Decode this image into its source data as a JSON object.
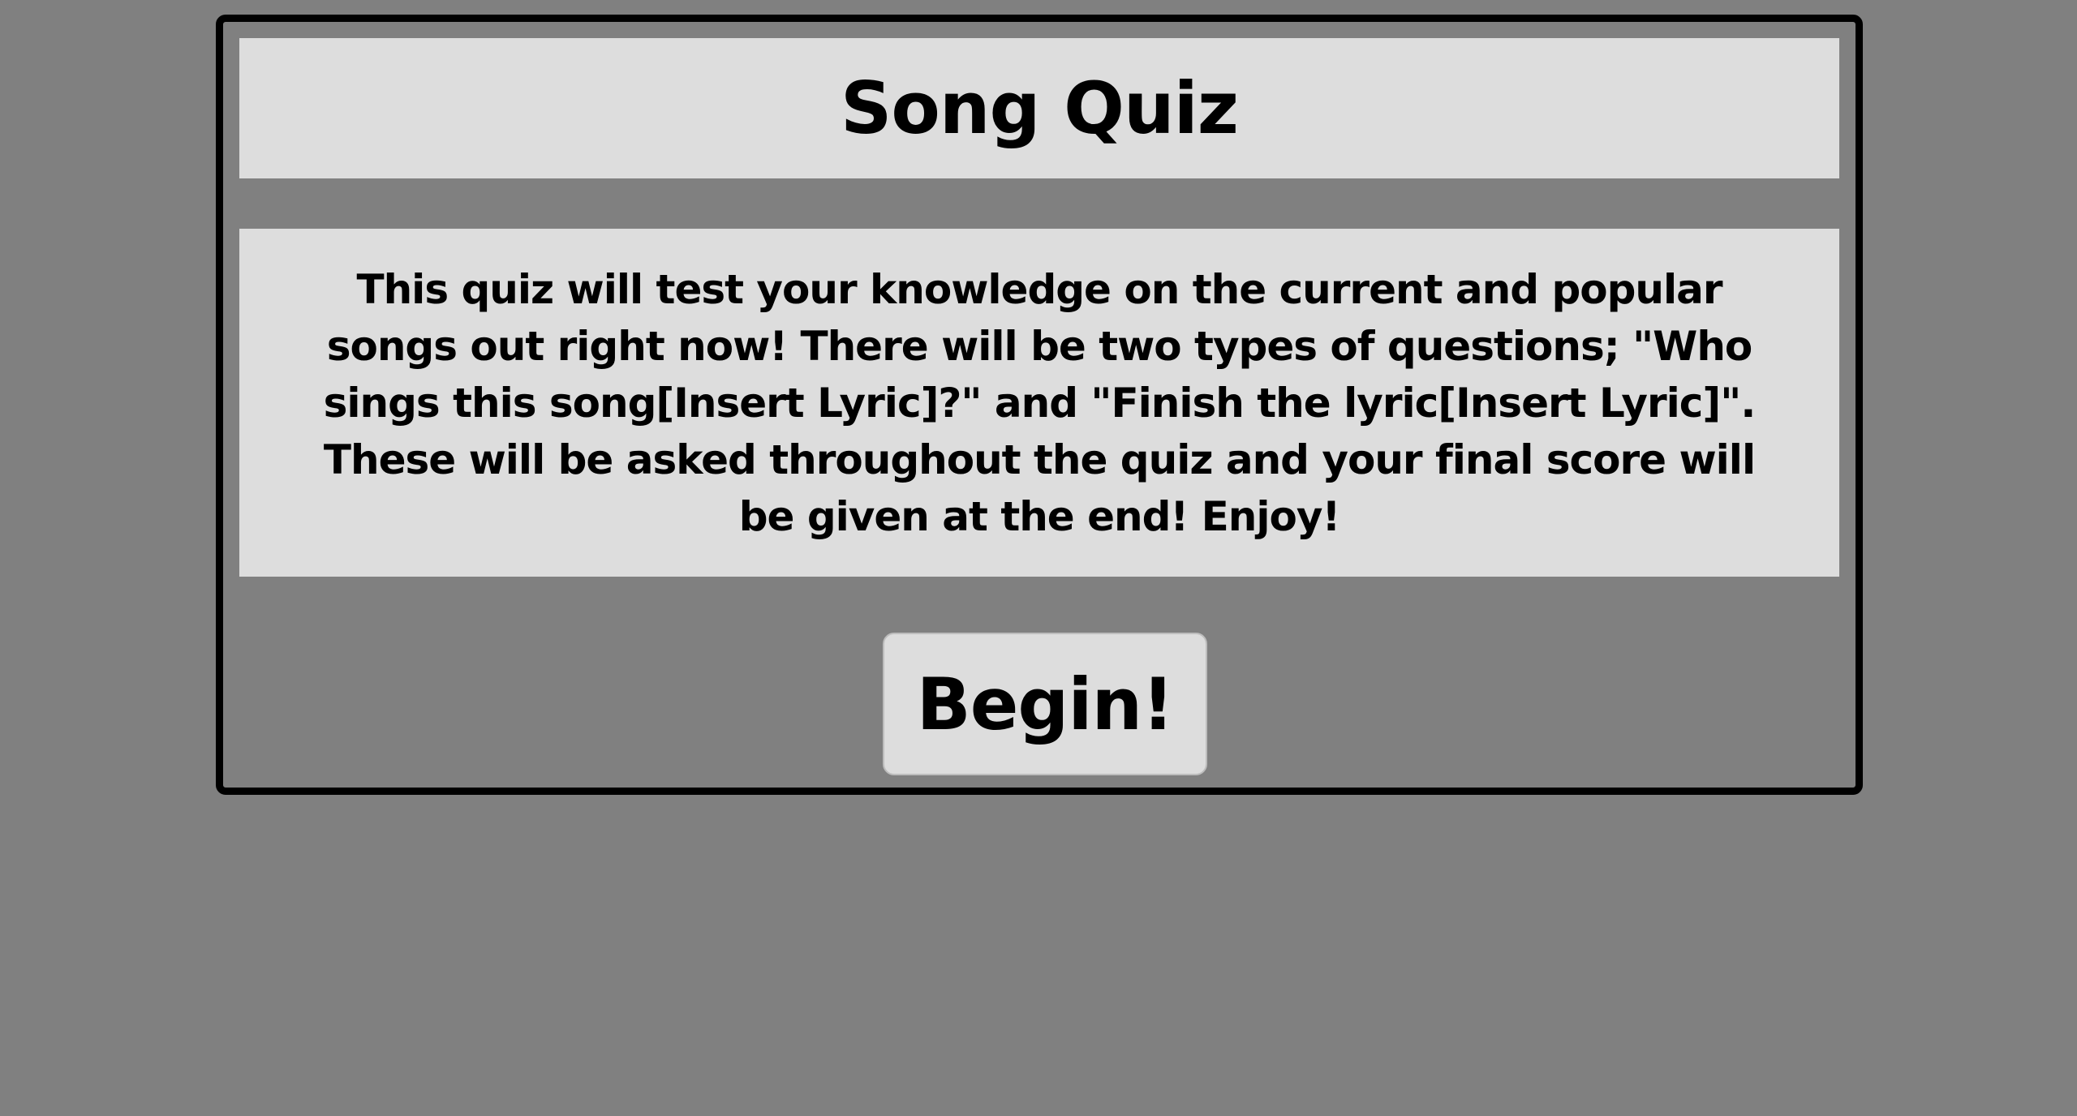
{
  "quiz": {
    "title": "Song Quiz",
    "description": "This quiz will test your knowledge on the current and popular songs out right now! There will be two types of questions; \"Who sings this song[Insert Lyric]?\" and \"Finish the lyric[Insert Lyric]\". These will be asked throughout the quiz and your final score will be given at the end! Enjoy!",
    "begin_label": "Begin!"
  },
  "colors": {
    "background": "#808080",
    "panel": "#dddddd",
    "border": "#000000",
    "text": "#000000"
  }
}
